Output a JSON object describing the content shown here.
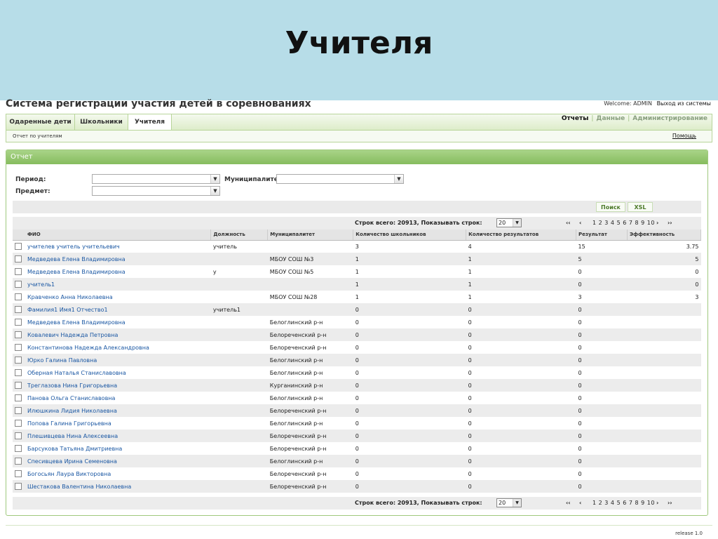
{
  "slide": {
    "title": "Учителя"
  },
  "app": {
    "title": "Система регистрации участия детей в соревнованиях",
    "welcome": "Welcome: ADMIN",
    "logout": "Выход из системы",
    "release": "release 1.0"
  },
  "tabs": [
    {
      "label": "Одаренные дети",
      "active": false
    },
    {
      "label": "Школьники",
      "active": false
    },
    {
      "label": "Учителя",
      "active": true
    }
  ],
  "top_menu": {
    "reports": "Отчеты",
    "data": "Данные",
    "admin": "Администрирование"
  },
  "subbar": {
    "crumb": "Отчет по учителям",
    "help": "Помощь"
  },
  "panel": {
    "title": "Отчет"
  },
  "filters": {
    "period_label": "Период:",
    "municipality_label": "Муниципалитет:",
    "subject_label": "Предмет:"
  },
  "buttons": {
    "search": "Поиск",
    "xsl": "XSL"
  },
  "pager": {
    "count_text": "Строк всего: 20913, Показывать строк:",
    "page_size": "20",
    "first": "‹‹",
    "prev": "‹",
    "pages": [
      "1",
      "2",
      "3",
      "4",
      "5",
      "6",
      "7",
      "8",
      "9",
      "10"
    ],
    "next": "›",
    "last": "››"
  },
  "table": {
    "columns": [
      "ФИО",
      "Должность",
      "Муниципалитет",
      "Количество школьников",
      "Количество результатов",
      "Результат",
      "Эффективность"
    ],
    "rows": [
      [
        "учителев учитель учительевич",
        "учитель",
        "",
        "3",
        "4",
        "15",
        "3.75"
      ],
      [
        "Медведева Елена Владимировна",
        "",
        "МБОУ СОШ №3",
        "1",
        "1",
        "5",
        "5"
      ],
      [
        "Медведева Елена Владимировна",
        "у",
        "МБОУ СОШ №5",
        "1",
        "1",
        "0",
        "0"
      ],
      [
        "учитель1",
        "",
        "",
        "1",
        "1",
        "0",
        "0"
      ],
      [
        "Кравченко Анна Николаевна",
        "",
        "МБОУ СОШ №28",
        "1",
        "1",
        "3",
        "3"
      ],
      [
        "Фамилия1 Имя1 Отчество1",
        "учитель1",
        "",
        "0",
        "0",
        "0",
        ""
      ],
      [
        "Медведева Елена Владимировна",
        "",
        "Белоглинский р-н",
        "0",
        "0",
        "0",
        ""
      ],
      [
        "Ковалевич Надежда Петровна",
        "",
        "Белореченский р-н",
        "0",
        "0",
        "0",
        ""
      ],
      [
        "Константинова Надежда Александровна",
        "",
        "Белореченский р-н",
        "0",
        "0",
        "0",
        ""
      ],
      [
        "Юрко Галина Павловна",
        "",
        "Белоглинский р-н",
        "0",
        "0",
        "0",
        ""
      ],
      [
        "Оберная Наталья Станиславовна",
        "",
        "Белоглинский р-н",
        "0",
        "0",
        "0",
        ""
      ],
      [
        "Треглазова Нина Григорьевна",
        "",
        "Курганинский р-н",
        "0",
        "0",
        "0",
        ""
      ],
      [
        "Панова Ольга Станиславовна",
        "",
        "Белоглинский р-н",
        "0",
        "0",
        "0",
        ""
      ],
      [
        "Илюшкина Лидия Николаевна",
        "",
        "Белореченский р-н",
        "0",
        "0",
        "0",
        ""
      ],
      [
        "Попова Галина Григорьевна",
        "",
        "Белоглинский р-н",
        "0",
        "0",
        "0",
        ""
      ],
      [
        "Плешивцева Нина Алексеевна",
        "",
        "Белореченский р-н",
        "0",
        "0",
        "0",
        ""
      ],
      [
        "Барсукова Татьяна Дмитриевна",
        "",
        "Белореченский р-н",
        "0",
        "0",
        "0",
        ""
      ],
      [
        "Спесивцева Ирина Семеновна",
        "",
        "Белоглинский р-н",
        "0",
        "0",
        "0",
        ""
      ],
      [
        "Богосьян Лаура Викторовна",
        "",
        "Белореченский р-н",
        "0",
        "0",
        "0",
        ""
      ],
      [
        "Шестакова Валентина Николаевна",
        "",
        "Белореченский р-н",
        "0",
        "0",
        "0",
        ""
      ]
    ]
  }
}
